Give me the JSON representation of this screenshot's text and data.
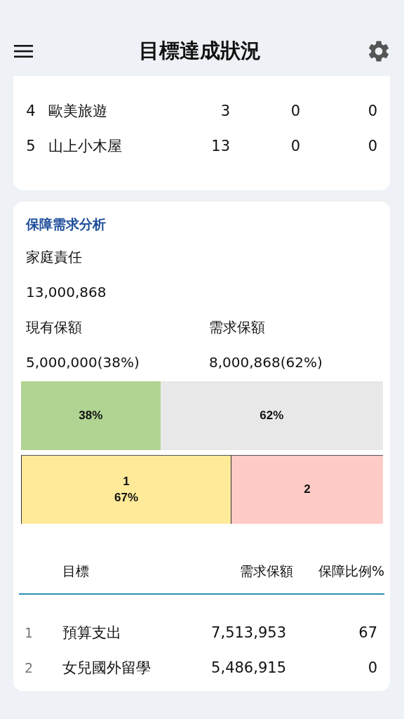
{
  "header": {
    "title": "目標達成狀況"
  },
  "goals_table": {
    "rows": [
      {
        "index": "4",
        "name": "歐美旅遊",
        "column_3": "3",
        "column_4": "0",
        "column_5": "0"
      },
      {
        "index": "5",
        "name": "山上小木屋",
        "column_3": "13",
        "column_4": "0",
        "column_5": "0"
      }
    ]
  },
  "protection": {
    "title": "保障需求分析",
    "family_label": "家庭責任",
    "family_value": "13,000,868",
    "existing_label": "現有保額",
    "existing_value": "5,000,000(38%)",
    "needed_label": "需求保額",
    "needed_value": "8,000,868(62%)",
    "coverage_bar": {
      "segments": [
        {
          "label": "38%",
          "color": "#b0d492"
        },
        {
          "label": "62%",
          "color": "#e8e8e8"
        }
      ]
    },
    "goal_blocks": [
      {
        "lines": [
          "1",
          "67%"
        ],
        "color": "#ffea99"
      },
      {
        "lines": [
          "2"
        ],
        "color": "#ffcbc7"
      }
    ],
    "table": {
      "columns": [
        "目標",
        "需求保額",
        "保障比例%"
      ],
      "rows": [
        {
          "index": "1",
          "goal": "預算支出",
          "amount": "7,513,953",
          "ratio": "67"
        },
        {
          "index": "2",
          "goal": "女兒國外留學",
          "amount": "5,486,915",
          "ratio": "0"
        }
      ]
    }
  }
}
